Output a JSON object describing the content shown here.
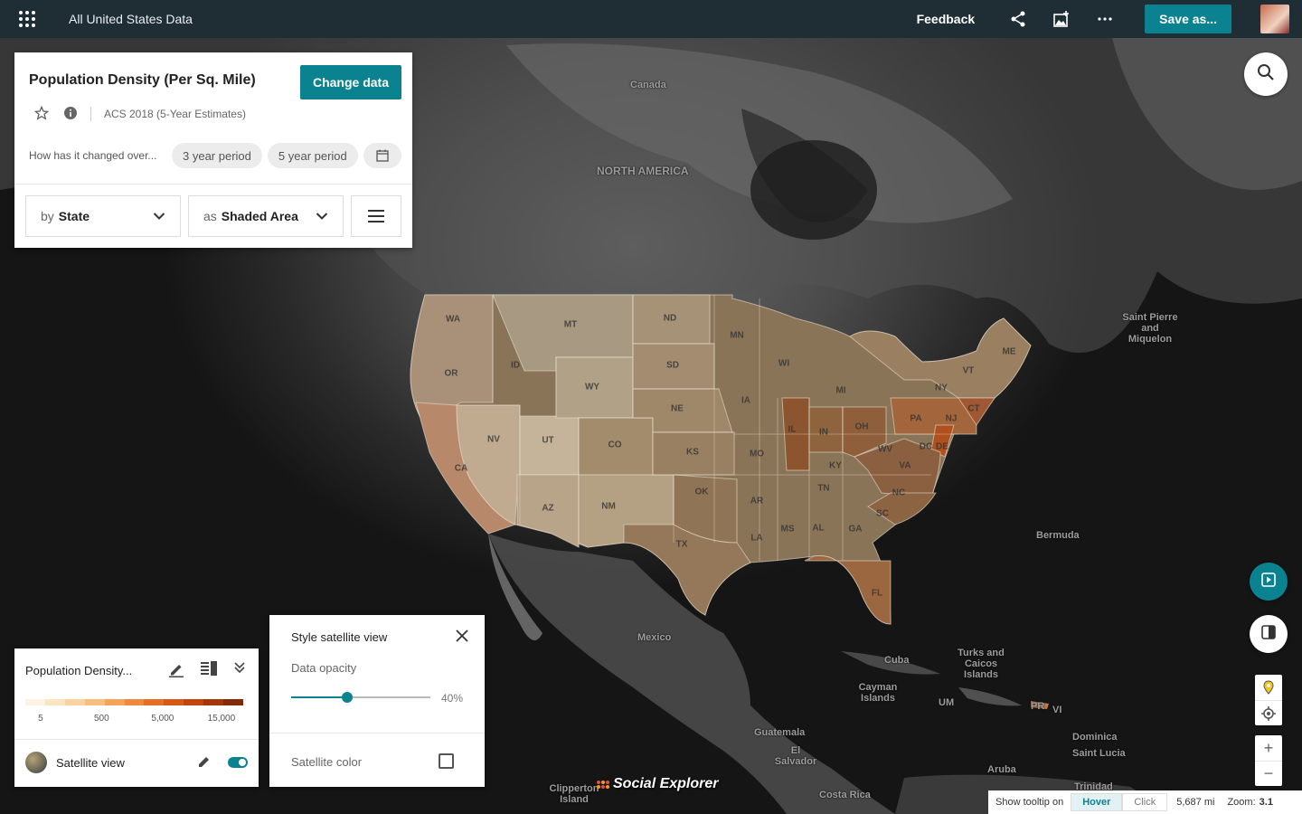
{
  "topbar": {
    "title": "All United States Data",
    "feedback": "Feedback",
    "save_label": "Save as..."
  },
  "data_panel": {
    "title": "Population Density (Per Sq. Mile)",
    "change_button": "Change data",
    "survey": "ACS 2018 (5-Year Estimates)",
    "change_question": "How has it changed over...",
    "period_3": "3 year period",
    "period_5": "5 year period",
    "by_prefix": "by",
    "by_value": "State",
    "as_prefix": "as",
    "as_value": "Shaded Area"
  },
  "legend": {
    "title": "Population Density...",
    "colors": [
      "#fdf3e4",
      "#fde5c4",
      "#fcd3a0",
      "#f9bd7c",
      "#f5a358",
      "#ef8a3c",
      "#e66f26",
      "#d65916",
      "#c0460e",
      "#a3360a",
      "#852a08"
    ],
    "labels": [
      "5",
      "500",
      "5,000",
      "15,000"
    ],
    "satellite_label": "Satellite view",
    "satellite_on": true
  },
  "style_popup": {
    "title": "Style satellite view",
    "opacity_label": "Data opacity",
    "opacity_value": "40%",
    "opacity_fraction": 0.4,
    "color_label": "Satellite color"
  },
  "map": {
    "places": [
      {
        "name": "Canada"
      },
      {
        "name": "NORTH AMERICA"
      },
      {
        "name": "Saint Pierre and Miquelon"
      },
      {
        "name": "Bermuda"
      },
      {
        "name": "Mexico"
      },
      {
        "name": "Cuba"
      },
      {
        "name": "Turks and Caicos Islands"
      },
      {
        "name": "Cayman Islands"
      },
      {
        "name": "UM"
      },
      {
        "name": "PR"
      },
      {
        "name": "VI"
      },
      {
        "name": "Dominica"
      },
      {
        "name": "Saint Lucia"
      },
      {
        "name": "Guatemala"
      },
      {
        "name": "El Salvador"
      },
      {
        "name": "Aruba"
      },
      {
        "name": "Trinidad"
      },
      {
        "name": "Clipperton Island"
      },
      {
        "name": "Costa Rica"
      }
    ],
    "states": [
      "WA",
      "OR",
      "CA",
      "ID",
      "NV",
      "MT",
      "WY",
      "UT",
      "AZ",
      "CO",
      "NM",
      "ND",
      "SD",
      "NE",
      "KS",
      "OK",
      "TX",
      "MN",
      "IA",
      "MO",
      "AR",
      "LA",
      "WI",
      "IL",
      "MI",
      "IN",
      "OH",
      "KY",
      "TN",
      "MS",
      "AL",
      "GA",
      "FL",
      "SC",
      "NC",
      "VA",
      "WV",
      "PA",
      "NY",
      "VT",
      "ME",
      "CT",
      "NJ",
      "DC",
      "DE"
    ]
  },
  "brand": "Social Explorer",
  "status": {
    "tooltip_label": "Show tooltip on",
    "hover": "Hover",
    "click": "Click",
    "distance": "5,687 mi",
    "zoom_label": "Zoom:",
    "zoom_value": "3.1"
  }
}
